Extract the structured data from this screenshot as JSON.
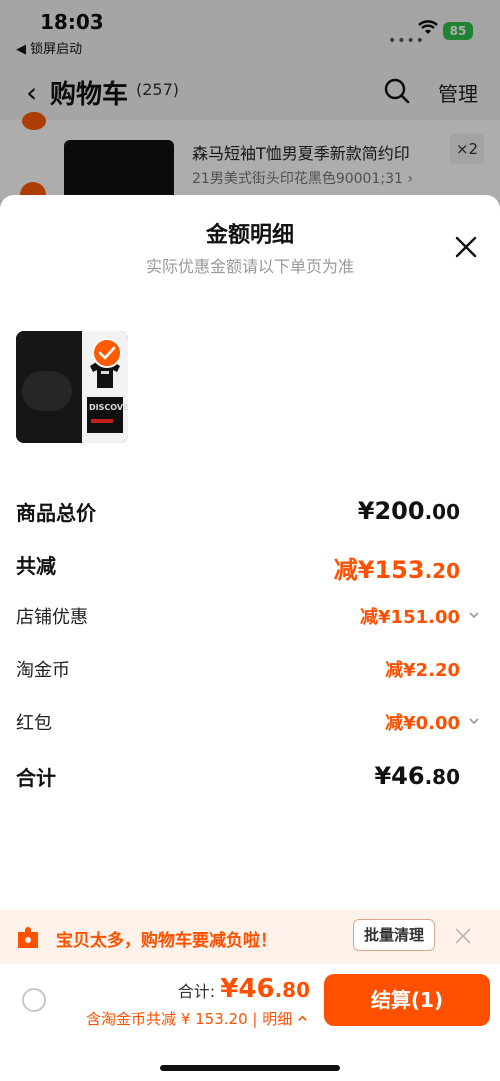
{
  "status": {
    "time": "18:03",
    "back_app": "◀ 锁屏启动",
    "battery": "85"
  },
  "cart": {
    "back": "‹",
    "title": "购物车",
    "count": "(257)",
    "manage": "管理",
    "item": {
      "title": "森马短袖T恤男夏季新款简约印",
      "sku": "21男美式街头印花黑色90001;31 ›",
      "qty": "×2"
    }
  },
  "sheet": {
    "title": "金额明细",
    "subtitle": "实际优惠金额请以下单页为准",
    "product_print_text": "DISCOVE",
    "rows": {
      "goods_total": {
        "label": "商品总价",
        "currency": "¥",
        "int": "200",
        "dec": ".00"
      },
      "total_reduce": {
        "label": "共减",
        "prefix": "减¥",
        "int": "153",
        "dec": ".20"
      },
      "shop_discount": {
        "label": "店铺优惠",
        "value": "减¥151.00"
      },
      "taobao_coin": {
        "label": "淘金币",
        "value": "减¥2.20"
      },
      "red_packet": {
        "label": "红包",
        "value": "减¥0.00"
      },
      "sum": {
        "label": "合计",
        "currency": "¥",
        "int": "46",
        "dec": ".80"
      }
    }
  },
  "banner": {
    "text": "宝贝太多，购物车要减负啦！",
    "button": "批量清理"
  },
  "bottom": {
    "total_label": "合计:",
    "total_currency": "¥",
    "total_int": "46",
    "total_dec": ".80",
    "discount_text": "含淘金币共减 ¥ 153.20 | ",
    "detail_link": "明细",
    "checkout": "结算(1)"
  },
  "colors": {
    "accent": "#ff5000",
    "battery": "#2fc24a",
    "banner_bg": "#fff2ea"
  },
  "icons": [
    "wifi-icon",
    "search-icon",
    "close-icon",
    "check-icon",
    "chevron-down-icon",
    "puzzle-icon",
    "chevron-up-icon"
  ]
}
